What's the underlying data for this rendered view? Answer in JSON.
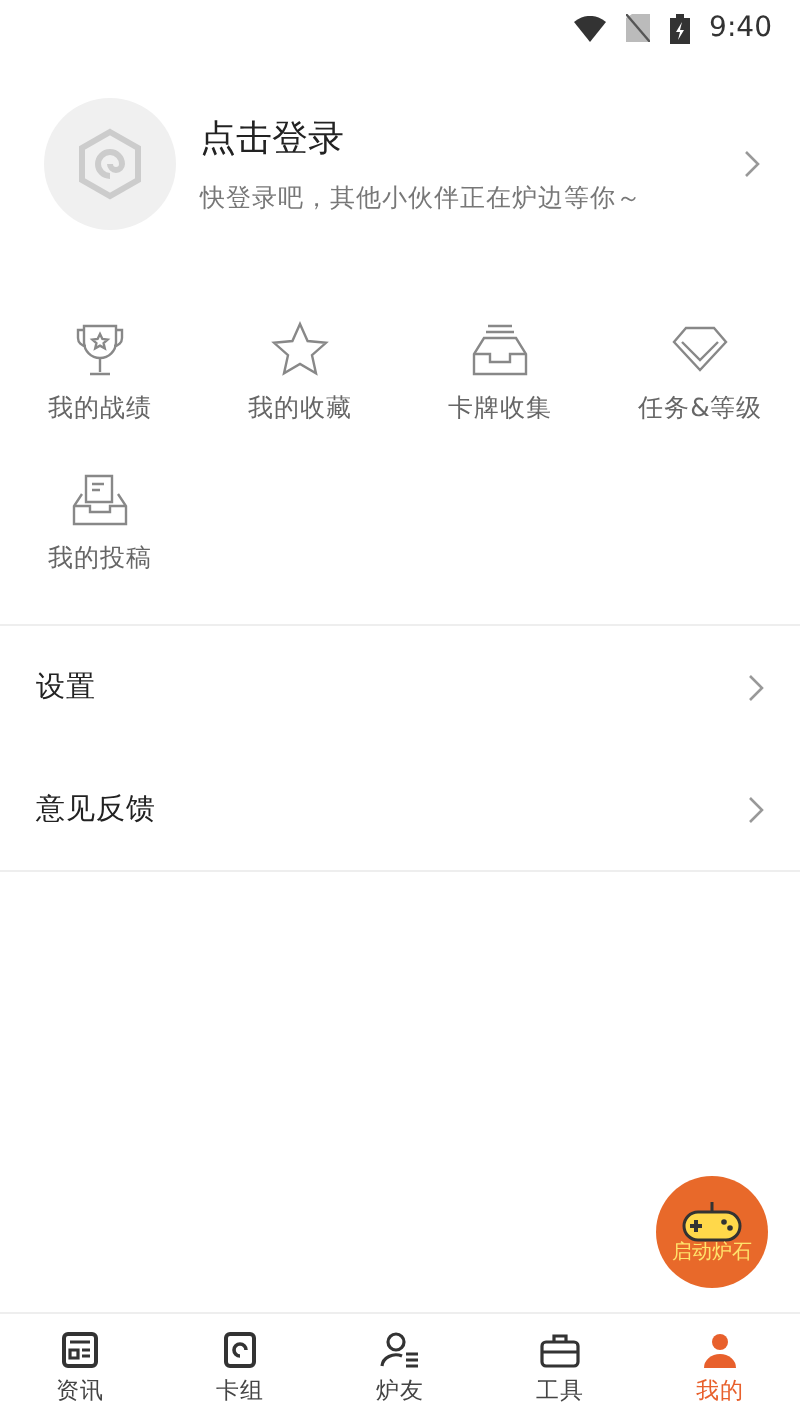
{
  "status_bar": {
    "time": "9:40"
  },
  "profile": {
    "title": "点击登录",
    "subtitle": "快登录吧，其他小伙伴正在炉边等你～"
  },
  "shortcuts": [
    {
      "kind": "trophy",
      "label": "我的战绩"
    },
    {
      "kind": "star",
      "label": "我的收藏"
    },
    {
      "kind": "cards",
      "label": "卡牌收集"
    },
    {
      "kind": "diamond",
      "label": "任务&等级"
    },
    {
      "kind": "tray",
      "label": "我的投稿"
    }
  ],
  "menu": [
    {
      "label": "设置"
    },
    {
      "label": "意见反馈"
    }
  ],
  "floating_button": {
    "label": "启动炉石"
  },
  "tab_bar": [
    {
      "kind": "news",
      "label": "资讯",
      "selected": false
    },
    {
      "kind": "deck",
      "label": "卡组",
      "selected": false
    },
    {
      "kind": "friends",
      "label": "炉友",
      "selected": false
    },
    {
      "kind": "tools",
      "label": "工具",
      "selected": false
    },
    {
      "kind": "me",
      "label": "我的",
      "selected": true
    }
  ]
}
